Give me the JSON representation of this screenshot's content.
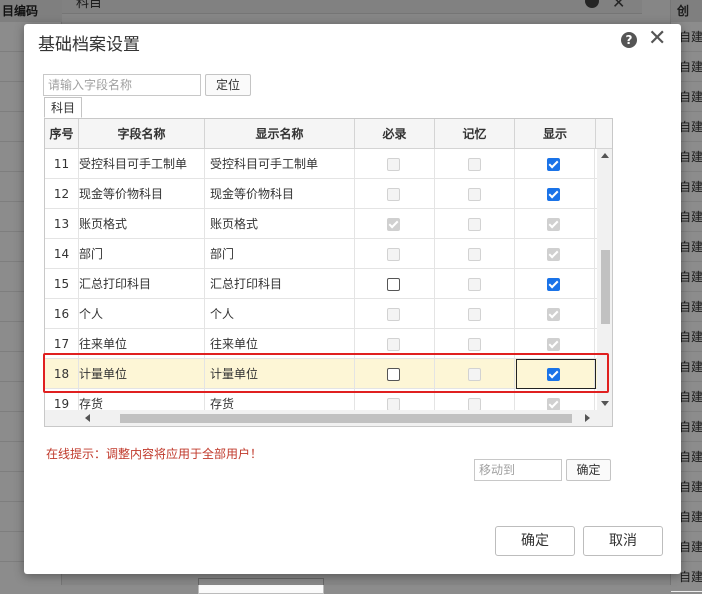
{
  "background": {
    "left_header": "目编码",
    "underlying_dialog_title": "科目",
    "right_header": "创",
    "right_cells": [
      "自建",
      "自建",
      "自建",
      "自建",
      "自建",
      "自建",
      "自建",
      "自建",
      "自建",
      "自建",
      "自建",
      "自建",
      "自建",
      "自建",
      "自建",
      "自建",
      "自建",
      "自建",
      "自建"
    ]
  },
  "dialog": {
    "title": "基础档案设置",
    "help_icon": "question-circle-icon",
    "close_icon": "close-icon",
    "search": {
      "placeholder": "请输入字段名称",
      "value": ""
    },
    "locate_label": "定位",
    "tab_label": "科目",
    "columns": [
      "序号",
      "字段名称",
      "显示名称",
      "必录",
      "记忆",
      "显示"
    ],
    "rows": [
      {
        "seq": "11",
        "field": "受控科目可手工制单",
        "display": "受控科目可手工制单",
        "required": "enabled-unchecked-disabled",
        "memory": "disabled",
        "show": "checked"
      },
      {
        "seq": "12",
        "field": "现金等价物科目",
        "display": "现金等价物科目",
        "required": "disabled",
        "memory": "disabled",
        "show": "checked"
      },
      {
        "seq": "13",
        "field": "账页格式",
        "display": "账页格式",
        "required": "checked-disabled",
        "memory": "disabled",
        "show": "checked-disabled"
      },
      {
        "seq": "14",
        "field": "部门",
        "display": "部门",
        "required": "disabled",
        "memory": "disabled",
        "show": "checked-disabled"
      },
      {
        "seq": "15",
        "field": "汇总打印科目",
        "display": "汇总打印科目",
        "required": "enabled",
        "memory": "disabled",
        "show": "checked"
      },
      {
        "seq": "16",
        "field": "个人",
        "display": "个人",
        "required": "disabled",
        "memory": "disabled",
        "show": "checked-disabled"
      },
      {
        "seq": "17",
        "field": "往来单位",
        "display": "往来单位",
        "required": "disabled",
        "memory": "disabled",
        "show": "checked-disabled"
      },
      {
        "seq": "18",
        "field": "计量单位",
        "display": "计量单位",
        "required": "enabled",
        "memory": "disabled",
        "show": "checked",
        "selected": true
      },
      {
        "seq": "19",
        "field": "存货",
        "display": "存货",
        "required": "disabled",
        "memory": "disabled",
        "show": "checked-disabled"
      }
    ],
    "hint": "在线提示：调整内容将应用于全部用户！",
    "move_to": {
      "placeholder": "移动到",
      "value": ""
    },
    "move_ok_label": "确定",
    "ok_label": "确定",
    "cancel_label": "取消",
    "colors": {
      "highlight": "#e02020",
      "checkbox_checked": "#1a73e8",
      "selected_row": "#fdf6d6",
      "hint": "#c0392b"
    }
  }
}
